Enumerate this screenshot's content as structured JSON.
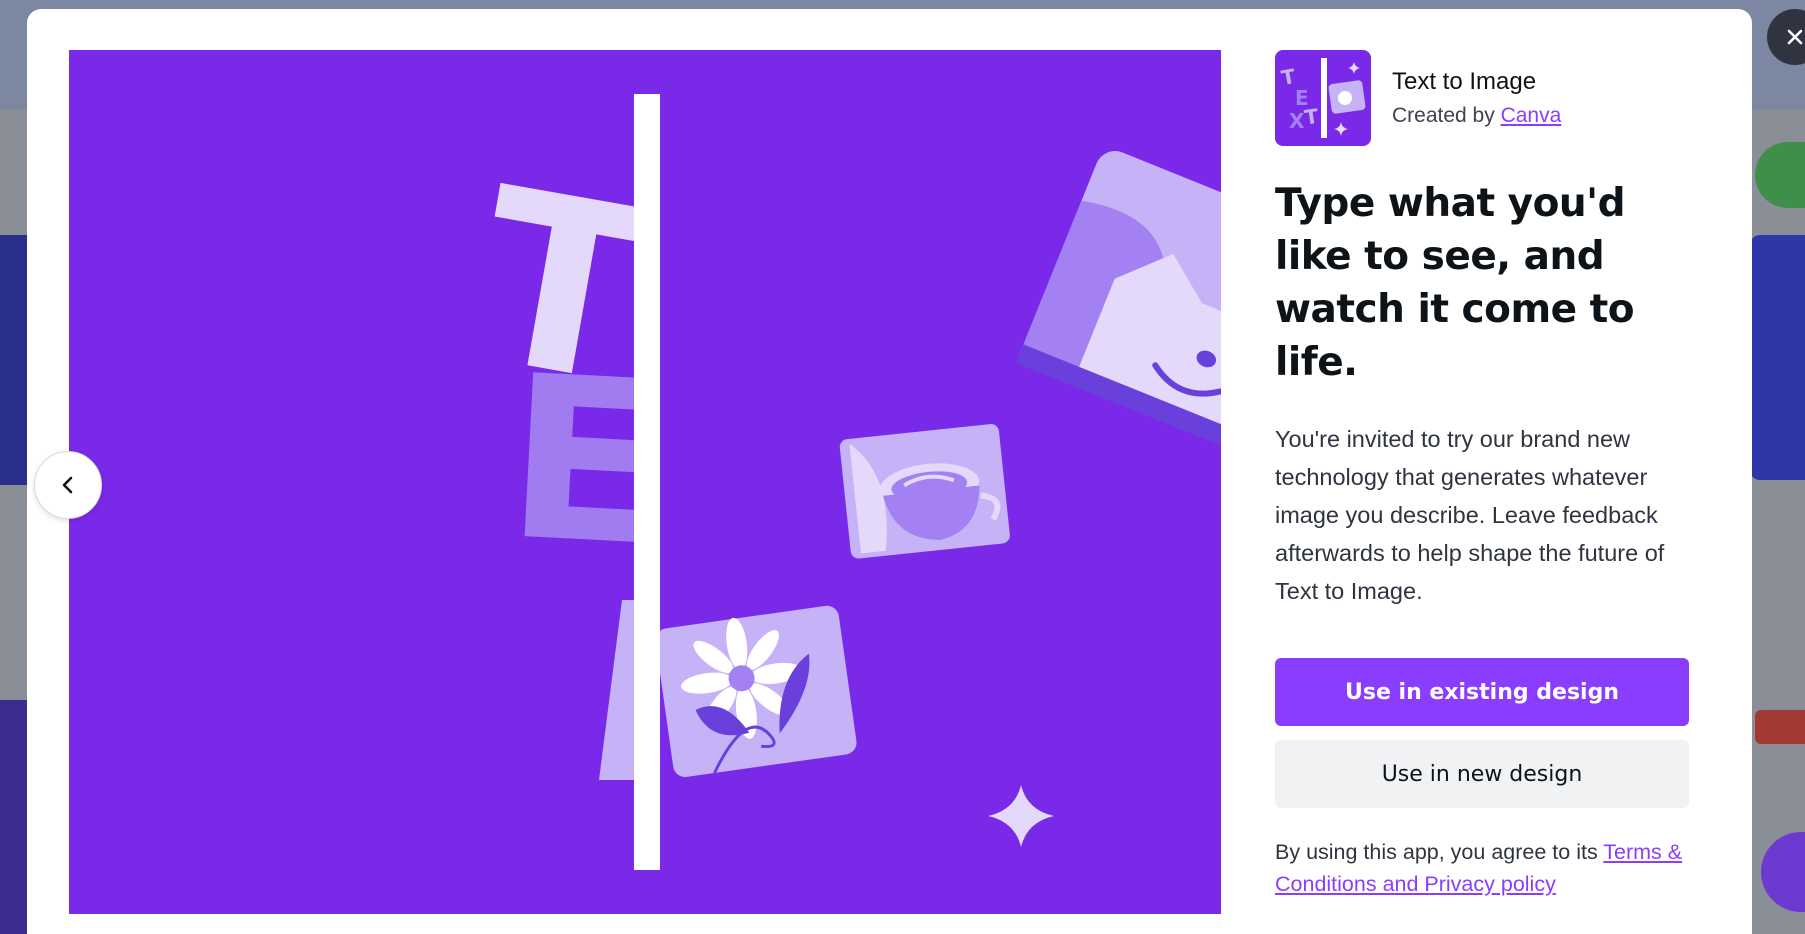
{
  "colors": {
    "brand_purple": "#8b3dff",
    "hero_bg": "#7a29e8",
    "text_dark": "#0e1318",
    "secondary_button_bg": "#f1f2f4"
  },
  "modal": {
    "close_icon": "close-icon",
    "prev_icon": "chevron-left-icon",
    "hero_letters": [
      "T",
      "E"
    ]
  },
  "app": {
    "name": "Text to Image",
    "created_by_prefix": "Created by",
    "creator": "Canva"
  },
  "headline": "Type what you'd like to see, and watch it come to life.",
  "description": "You're invited to try our brand new technology that generates whatever image you describe. Leave feedback afterwards to help shape the future of Text to Image.",
  "actions": {
    "primary": "Use in existing design",
    "secondary": "Use in new design"
  },
  "legal": {
    "prefix": "By using this app, you agree to its ",
    "link": "Terms & Conditions and Privacy policy"
  }
}
